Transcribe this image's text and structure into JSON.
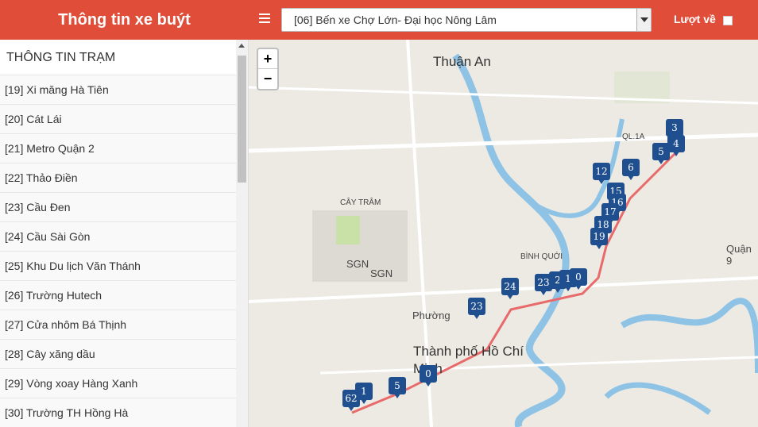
{
  "header": {
    "title": "Thông tin xe buýt",
    "menu_icon": "hamburger-icon",
    "route_selected": "[06] Bến xe Chợ Lớn- Đại học Nông Lâm",
    "return_label": "Lượt về"
  },
  "sidebar": {
    "title": "THÔNG TIN TRẠM",
    "stops": [
      {
        "label": "[19] Xi măng Hà Tiên"
      },
      {
        "label": "[20] Cát Lái"
      },
      {
        "label": "[21] Metro Quận 2"
      },
      {
        "label": "[22] Thảo Điền"
      },
      {
        "label": "[23] Cầu Đen"
      },
      {
        "label": "[24] Cầu Sài Gòn"
      },
      {
        "label": "[25] Khu Du lịch Văn Thánh"
      },
      {
        "label": "[26] Trường Hutech"
      },
      {
        "label": "[27] Cửa nhôm Bá Thịnh"
      },
      {
        "label": "[28] Cây xăng dầu"
      },
      {
        "label": "[29] Vòng xoay Hàng Xanh"
      },
      {
        "label": "[30] Trường TH Hồng Hà"
      }
    ]
  },
  "map": {
    "zoom_in": "+",
    "zoom_out": "−",
    "labels": {
      "thuan_an": "Thuận An",
      "sgn1": "SGN",
      "sgn2": "SGN",
      "city": "Thành phố Hồ Chí Minh",
      "phuong": "Phường",
      "quan9": "Quận 9",
      "qt": "QL.1A",
      "cay_tram": "CÂY TRÂM",
      "binh_quoi": "BÌNH QUỚI"
    },
    "markers": [
      "3",
      "4",
      "5",
      "6",
      "12",
      "15",
      "16",
      "17",
      "18",
      "19",
      "24",
      "23",
      "2",
      "1",
      "0",
      "23",
      "5",
      "1",
      "62",
      "0"
    ],
    "route_color": "#e86a6a",
    "marker_color": "#1f4f8e"
  }
}
